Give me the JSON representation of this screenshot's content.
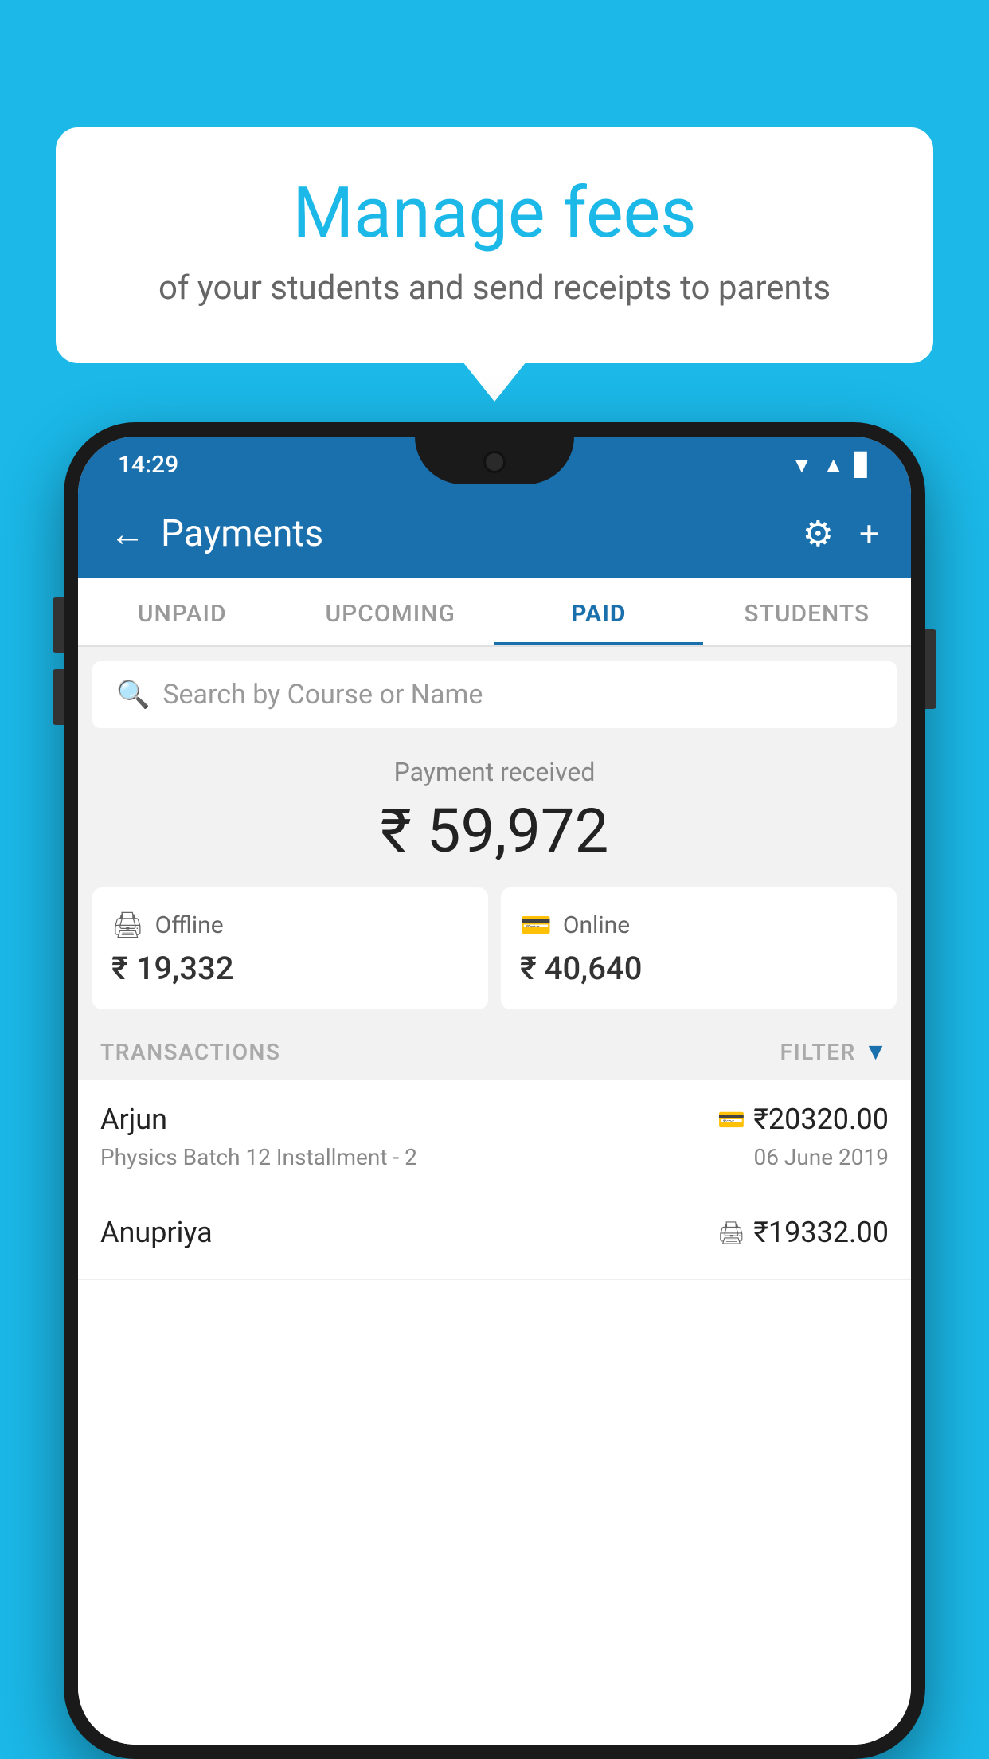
{
  "background_color": "#1BB8E8",
  "bubble": {
    "title": "Manage fees",
    "subtitle": "of your students and send receipts to parents"
  },
  "status_bar": {
    "time": "14:29",
    "wifi": "▲",
    "signal": "▲",
    "battery": "▊"
  },
  "header": {
    "title": "Payments",
    "back_label": "←",
    "gear_label": "⚙",
    "plus_label": "+"
  },
  "tabs": [
    {
      "label": "UNPAID",
      "active": false
    },
    {
      "label": "UPCOMING",
      "active": false
    },
    {
      "label": "PAID",
      "active": true
    },
    {
      "label": "STUDENTS",
      "active": false
    }
  ],
  "search": {
    "placeholder": "Search by Course or Name"
  },
  "payment_summary": {
    "label": "Payment received",
    "amount": "₹ 59,972"
  },
  "cards": [
    {
      "icon": "💳",
      "label": "Offline",
      "amount": "₹ 19,332"
    },
    {
      "icon": "💳",
      "label": "Online",
      "amount": "₹ 40,640"
    }
  ],
  "transactions_section": {
    "label": "TRANSACTIONS",
    "filter_label": "FILTER"
  },
  "transactions": [
    {
      "name": "Arjun",
      "amount": "₹20320.00",
      "payment_mode": "online",
      "course": "Physics Batch 12 Installment - 2",
      "date": "06 June 2019"
    },
    {
      "name": "Anupriya",
      "amount": "₹19332.00",
      "payment_mode": "offline",
      "course": "",
      "date": ""
    }
  ]
}
